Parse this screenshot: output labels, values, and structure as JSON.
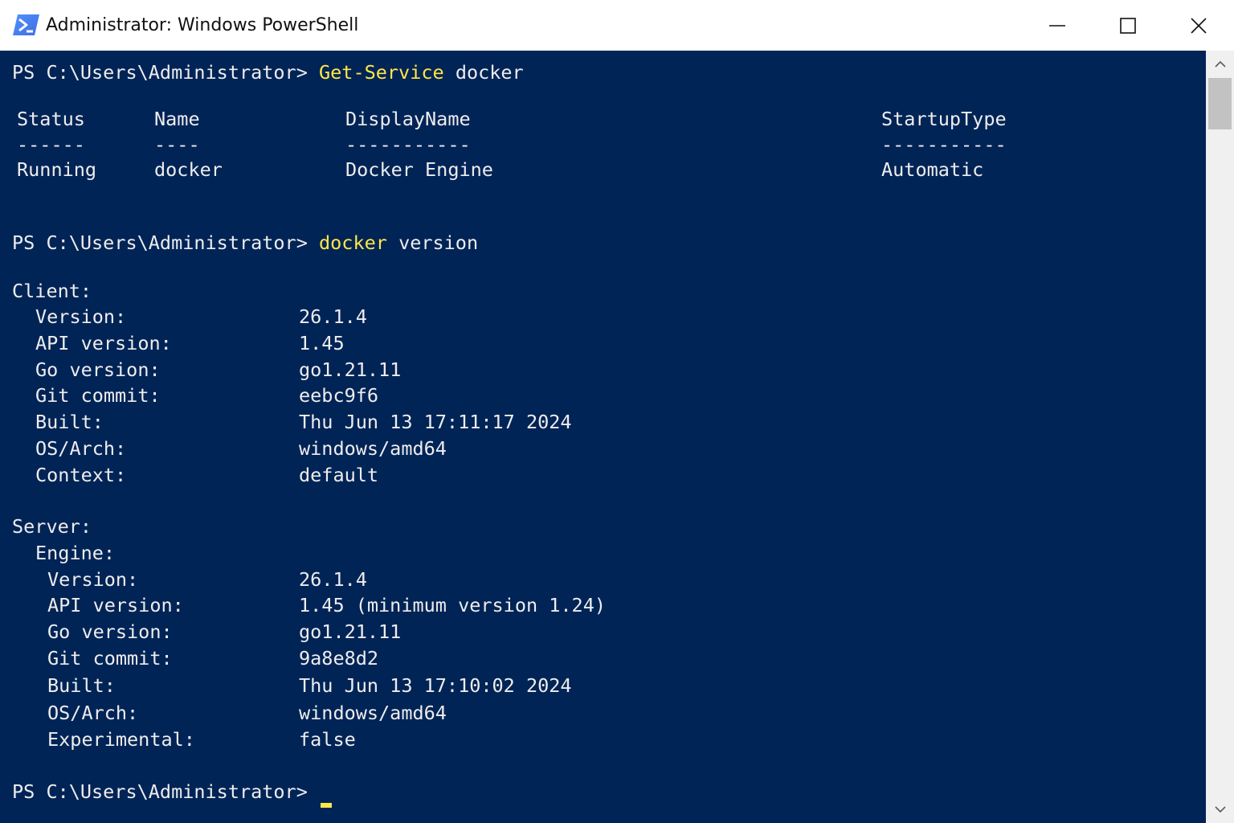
{
  "window": {
    "title": "Administrator: Windows PowerShell",
    "icon": "powershell-icon",
    "buttons": {
      "minimize": "minimize-icon",
      "maximize": "maximize-icon",
      "close": "close-icon"
    }
  },
  "colors": {
    "console_bg": "#012456",
    "text": "#eeeded",
    "command": "#fee74b",
    "titlebar_bg": "#ffffff"
  },
  "console": {
    "prompt": "PS C:\\Users\\Administrator>",
    "cmd1": {
      "command": "Get-Service",
      "args": "docker"
    },
    "service_table": {
      "headers": [
        "Status",
        "Name",
        "DisplayName",
        "StartupType"
      ],
      "underlines": [
        "------",
        "----",
        "-----------",
        "-----------"
      ],
      "rows": [
        [
          "Running",
          "docker",
          "Docker Engine",
          "Automatic"
        ]
      ]
    },
    "cmd2": {
      "command": "docker",
      "args": "version"
    },
    "client": {
      "heading": "Client:",
      "fields": [
        {
          "key": "Version:",
          "value": "26.1.4"
        },
        {
          "key": "API version:",
          "value": "1.45"
        },
        {
          "key": "Go version:",
          "value": "go1.21.11"
        },
        {
          "key": "Git commit:",
          "value": "eebc9f6"
        },
        {
          "key": "Built:",
          "value": "Thu Jun 13 17:11:17 2024"
        },
        {
          "key": "OS/Arch:",
          "value": "windows/amd64"
        },
        {
          "key": "Context:",
          "value": "default"
        }
      ]
    },
    "server": {
      "heading": "Server:",
      "engine_heading": "Engine:",
      "fields": [
        {
          "key": "Version:",
          "value": "26.1.4"
        },
        {
          "key": "API version:",
          "value": "1.45 (minimum version 1.24)"
        },
        {
          "key": "Go version:",
          "value": "go1.21.11"
        },
        {
          "key": "Git commit:",
          "value": "9a8e8d2"
        },
        {
          "key": "Built:",
          "value": "Thu Jun 13 17:10:02 2024"
        },
        {
          "key": "OS/Arch:",
          "value": "windows/amd64"
        },
        {
          "key": "Experimental:",
          "value": "false"
        }
      ]
    }
  },
  "scrollbar": {
    "up": "scroll-up-arrow-icon",
    "down": "scroll-down-arrow-icon"
  }
}
